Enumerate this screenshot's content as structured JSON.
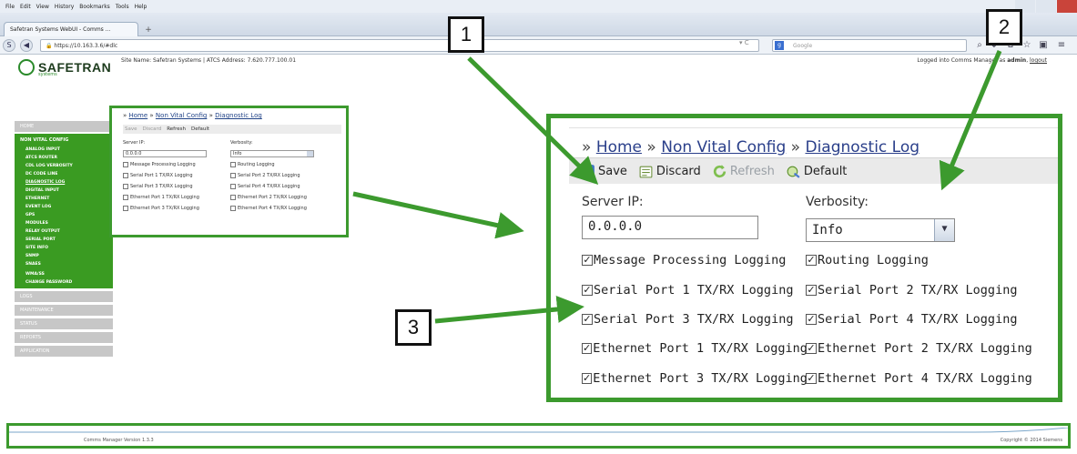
{
  "browser": {
    "menu": [
      "File",
      "Edit",
      "View",
      "History",
      "Bookmarks",
      "Tools",
      "Help"
    ],
    "tab_title": "Safetran Systems WebUI - Comms ...",
    "new_tab": "+",
    "url": "https://10.163.3.6/#dlc",
    "search_placeholder": "Google"
  },
  "header": {
    "logo_text": "SAFETRAN",
    "logo_sub": "systems",
    "site_info": "Site Name: Safetran Systems  |  ATCS Address: 7.620.777.100.01",
    "login_prefix": "Logged into Comms Manager as ",
    "login_user": "admin",
    "logout": "logout"
  },
  "sidebar": {
    "home": "HOME",
    "section": "NON VITAL CONFIG",
    "items": [
      "ANALOG INPUT",
      "ATCS ROUTER",
      "CDL LOG VERBOSITY",
      "DC CODE LINE",
      "DIAGNOSTIC LOG",
      "DIGITAL INPUT",
      "ETHERNET",
      "EVENT LOG",
      "GPS",
      "MODULES",
      "RELAY OUTPUT",
      "SERIAL PORT",
      "SITE INFO",
      "SNMP",
      "SNAES",
      "WMA/SS",
      "CHANGE PASSWORD"
    ],
    "active_index": 4,
    "grey_items": [
      "LOGS",
      "MAINTENANCE",
      "STATUS",
      "REPORTS",
      "APPLICATION"
    ]
  },
  "small_panel": {
    "crumb_prefix": "» ",
    "crumb_home": "Home",
    "crumb_mid": "Non Vital Config",
    "crumb_current": "Diagnostic Log",
    "sep": " » ",
    "toolbar": [
      "Save",
      "Discard",
      "Refresh",
      "Default"
    ],
    "server_ip_label": "Server IP:",
    "verbosity_label": "Verbosity:",
    "server_ip": "0.0.0.0",
    "verbosity": "Info",
    "checkboxes": [
      [
        "Message Processing Logging",
        "Routing Logging"
      ],
      [
        "Serial Port 1 TX/RX Logging",
        "Serial Port 2 TX/RX Logging"
      ],
      [
        "Serial Port 3 TX/RX Logging",
        "Serial Port 4 TX/RX Logging"
      ],
      [
        "Ethernet Port 1 TX/RX Logging",
        "Ethernet Port 2 TX/RX Logging"
      ],
      [
        "Ethernet Port 3 TX/RX Logging",
        "Ethernet Port 4 TX/RX Logging"
      ]
    ]
  },
  "big_panel": {
    "crumb_prefix": "» ",
    "crumb_home": "Home",
    "sep": " » ",
    "crumb_mid": "Non Vital Config",
    "crumb_current": "Diagnostic Log",
    "save": "Save",
    "discard": "Discard",
    "refresh": "Refresh",
    "default": "Default",
    "server_ip_label": "Server IP:",
    "verbosity_label": "Verbosity:",
    "server_ip": "0.0.0.0",
    "verbosity": "Info",
    "check_mark": "✓",
    "checkboxes": [
      [
        "Message Processing Logging",
        "Routing Logging"
      ],
      [
        "Serial Port 1 TX/RX Logging",
        "Serial Port 2 TX/RX Logging"
      ],
      [
        "Serial Port 3 TX/RX Logging",
        "Serial Port 4 TX/RX Logging"
      ],
      [
        "Ethernet Port 1 TX/RX Logging",
        "Ethernet Port 2 TX/RX Logging"
      ],
      [
        "Ethernet Port 3 TX/RX Logging",
        "Ethernet Port 4 TX/RX Logging"
      ]
    ]
  },
  "footer": {
    "version": "Comms Manager Version 1.3.3",
    "copyright": "Copyright © 2014 Siemens"
  },
  "callouts": [
    "1",
    "2",
    "3"
  ],
  "colors": {
    "highlight_green": "#3c9a2e",
    "sidebar_green": "#3a9b22",
    "link": "#2a3f8a"
  }
}
